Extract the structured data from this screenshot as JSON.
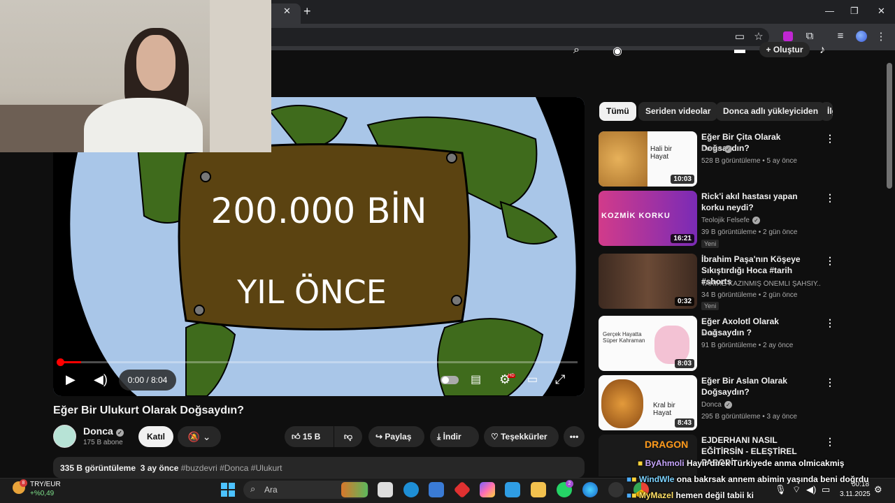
{
  "browser": {
    "new_tab_symbol": "+",
    "tab_close_symbol": "✕",
    "window_controls": [
      "—",
      "❐",
      "✕"
    ]
  },
  "youtube_header": {
    "create_label": "+ Oluştur"
  },
  "player": {
    "overlay_line1": "200.000 BİN",
    "overlay_line2": "YIL  ÖNCE",
    "time": "0:00 / 8:04",
    "progress": 0.0,
    "hd_badge": "HD"
  },
  "video": {
    "title": "Eğer Bir Ulukurt Olarak Doğsaydın?",
    "channel": "Donca",
    "subscribers": "175 B abone",
    "join_label": "Katıl",
    "likes": "15 B",
    "share_label": "Paylaş",
    "download_label": "İndir",
    "thanks_label": "Teşekkürler",
    "more_label": "•••",
    "views": "335 B görüntüleme",
    "date": "3 ay önce",
    "tags": "#buzdevri #Donca #Ulukurt"
  },
  "chips": [
    {
      "label": "Tümü"
    },
    {
      "label": "Seriden videolar"
    },
    {
      "label": "Donca adlı yükleyiciden"
    },
    {
      "label": "İlg"
    }
  ],
  "related": [
    {
      "title": "Eğer Bir Çita Olarak Doğsaydın?",
      "channel": "Donca",
      "meta": "528 B görüntüleme • 5 ay önce",
      "duration": "10:03",
      "badge": "",
      "thumb_text": "Hali bir Hayat"
    },
    {
      "title": "Rick'i akıl hastası yapan korku neydi?",
      "channel": "Teolojik Felsefe",
      "meta": "39 B görüntüleme • 2 gün önce",
      "duration": "16:21",
      "badge": "Yeni",
      "thumb_text": "KOZMİK KORKU"
    },
    {
      "title": "İbrahim Paşa'nın Köşeye Sıkıştırdığı Hoca #tarih #shorts",
      "channel": "TARİHE KAZINMIŞ ÖNEMLİ ŞAHSİY...",
      "meta": "34 B görüntüleme • 2 gün önce",
      "duration": "0:32",
      "badge": "Yeni",
      "thumb_text": ""
    },
    {
      "title": "Eğer Axolotl Olarak Doğsaydın ?",
      "channel": "Mozi",
      "meta": "91 B görüntüleme • 2 ay önce",
      "duration": "8:03",
      "badge": "",
      "thumb_text": "Gerçek Hayatta Süper Kahraman"
    },
    {
      "title": "Eğer Bir Aslan Olarak Doğsaydın?",
      "channel": "Donca",
      "meta": "295 B görüntüleme • 3 ay önce",
      "duration": "8:43",
      "badge": "",
      "thumb_text": "Kral bir Hayat"
    },
    {
      "title": "EJDERHANI NASIL EĞİTİRSİN - ELEŞTİREL PARODİ",
      "channel": "",
      "meta": "",
      "duration": "",
      "badge": "",
      "thumb_text": "DRAGON"
    }
  ],
  "chat": [
    {
      "user": "ByAhmoli",
      "text": "Hayır direk Türkiyede anma olmicakmiş"
    },
    {
      "user": "WindWle",
      "text": "ona bakrsak annem abimin yaşında beni doğrdu"
    },
    {
      "user": "MyMazel",
      "text": "hemen değil tabii ki"
    }
  ],
  "taskbar": {
    "weather_badge": "8",
    "ticker_name": "TRY/EUR",
    "ticker_change": "+%0,49",
    "search_placeholder": "Ara",
    "whatsapp_badge": "2",
    "time": "00:18",
    "date": "3.11.2025"
  },
  "colors": {
    "background": "#0f0f0f",
    "accent_red": "#ff0000",
    "chip_active": "#f1f1f1",
    "ocean": "#a9c6e8",
    "land": "#3f6b1c",
    "sign_board": "#5b4311"
  },
  "icons": [
    "search-icon",
    "mic-icon",
    "bell-icon",
    "star-icon",
    "extensions-icon",
    "play-icon",
    "volume-icon",
    "subtitles-icon",
    "settings-icon",
    "theater-icon",
    "fullscreen-icon",
    "like-icon",
    "dislike-icon",
    "share-icon",
    "download-icon",
    "thanks-icon",
    "windows-icon",
    "wifi-icon",
    "speaker-icon",
    "battery-icon"
  ]
}
